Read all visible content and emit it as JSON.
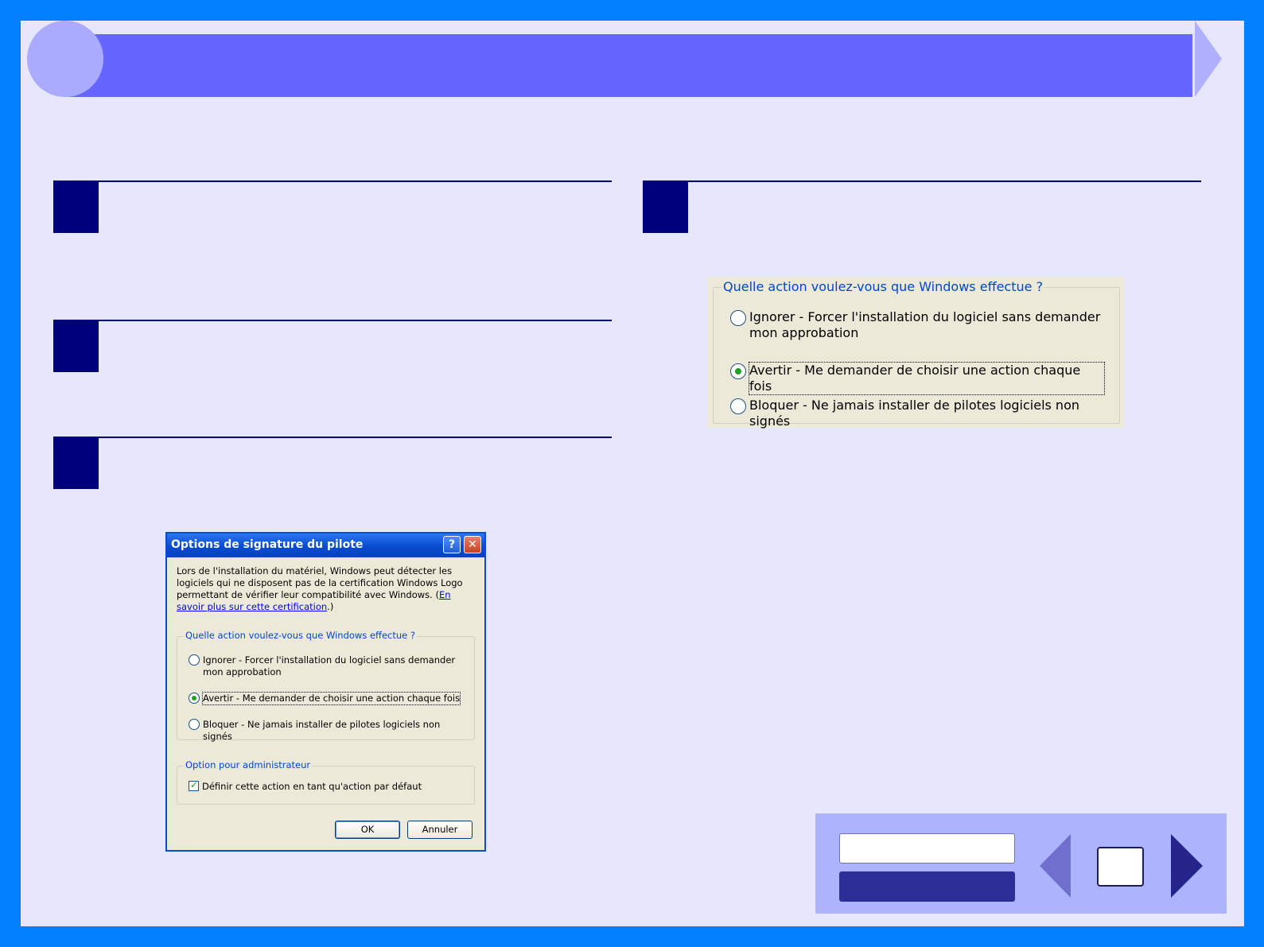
{
  "header": {
    "title": ""
  },
  "steps": [
    {
      "number": "",
      "text": ""
    },
    {
      "number": "",
      "text": ""
    },
    {
      "number": "",
      "text": ""
    },
    {
      "number": "",
      "text": ""
    }
  ],
  "dialog": {
    "title": "Options de signature du pilote",
    "help_button": "?",
    "close_button": "✕",
    "description": "Lors de l'installation du matériel, Windows peut détecter les logiciels qui ne disposent pas de la certification Windows Logo permettant de vérifier leur compatibilité avec Windows. (",
    "link": "En savoir plus sur cette certification",
    "description_end": ".)",
    "group_action_legend": "Quelle action voulez-vous que Windows effectue ?",
    "options": [
      {
        "label": "Ignorer - Forcer l'installation du logiciel sans demander mon approbation",
        "selected": false
      },
      {
        "label": "Avertir - Me demander de choisir une action chaque fois",
        "selected": true
      },
      {
        "label": "Bloquer - Ne jamais installer de pilotes logiciels non signés",
        "selected": false
      }
    ],
    "group_admin_legend": "Option pour administrateur",
    "admin_checkbox_label": "Définir cette action en tant qu'action par défaut",
    "admin_checkbox_checked": true,
    "ok_label": "OK",
    "cancel_label": "Annuler"
  },
  "zoom": {
    "legend": "Quelle action voulez-vous que Windows effectue ?",
    "options": [
      {
        "label": "Ignorer - Forcer l'installation du logiciel sans demander mon approbation",
        "selected": false
      },
      {
        "label": "Avertir - Me demander de choisir une action chaque fois",
        "selected": true
      },
      {
        "label": "Bloquer - Ne jamais installer de pilotes logiciels non signés",
        "selected": false
      }
    ]
  },
  "nav": {
    "prev_icon": "triangle-left-icon",
    "next_icon": "triangle-right-icon",
    "page_number": "",
    "button_top": "",
    "button_bottom": ""
  },
  "colors": {
    "frame": "#0080ff",
    "page": "#e6e6fc",
    "title_band": "#6666ff",
    "step_square": "#00007a",
    "nav_panel": "#aeb4fb",
    "nav_arrow_prev": "#6f6fce",
    "nav_arrow_next": "#24248a"
  }
}
